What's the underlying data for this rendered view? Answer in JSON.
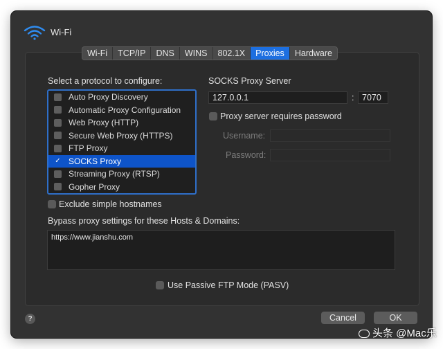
{
  "header": {
    "title": "Wi-Fi",
    "icon": "wifi-icon"
  },
  "tabs": [
    {
      "label": "Wi-Fi",
      "active": false
    },
    {
      "label": "TCP/IP",
      "active": false
    },
    {
      "label": "DNS",
      "active": false
    },
    {
      "label": "WINS",
      "active": false
    },
    {
      "label": "802.1X",
      "active": false
    },
    {
      "label": "Proxies",
      "active": true
    },
    {
      "label": "Hardware",
      "active": false
    }
  ],
  "protocols": {
    "label": "Select a protocol to configure:",
    "items": [
      {
        "label": "Auto Proxy Discovery",
        "checked": false
      },
      {
        "label": "Automatic Proxy Configuration",
        "checked": false
      },
      {
        "label": "Web Proxy (HTTP)",
        "checked": false
      },
      {
        "label": "Secure Web Proxy (HTTPS)",
        "checked": false
      },
      {
        "label": "FTP Proxy",
        "checked": false
      },
      {
        "label": "SOCKS Proxy",
        "checked": true,
        "check_glyph": "✓"
      },
      {
        "label": "Streaming Proxy (RTSP)",
        "checked": false
      },
      {
        "label": "Gopher Proxy",
        "checked": false
      }
    ]
  },
  "server": {
    "label": "SOCKS Proxy Server",
    "host": "127.0.0.1",
    "separator": ":",
    "port": "7070",
    "requires_password_label": "Proxy server requires password",
    "requires_password_checked": false,
    "username_label": "Username:",
    "username_value": "",
    "password_label": "Password:",
    "password_value": ""
  },
  "exclude_simple": {
    "label": "Exclude simple hostnames",
    "checked": false
  },
  "bypass": {
    "label": "Bypass proxy settings for these Hosts & Domains:",
    "value": "https://www.jianshu.com"
  },
  "passive_ftp": {
    "label": "Use Passive FTP Mode (PASV)",
    "checked": false
  },
  "footer": {
    "help_label": "?",
    "cancel_label": "Cancel",
    "ok_label": "OK"
  },
  "watermark": {
    "text": "头条 @Mac乐"
  },
  "colors": {
    "accent": "#1d6fe0",
    "selection": "#0e54c9",
    "window_bg": "#323232"
  }
}
